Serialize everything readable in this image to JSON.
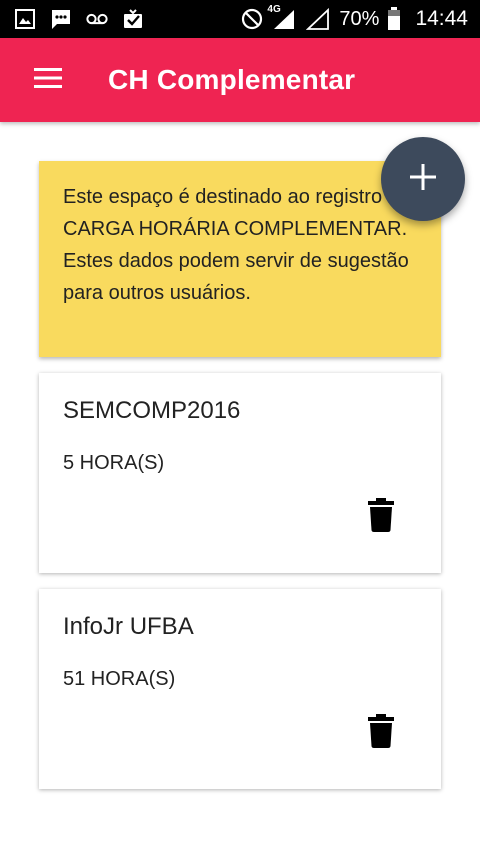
{
  "status_bar": {
    "left_icons": [
      "image-icon",
      "message-icon",
      "voicemail-icon",
      "download-done-icon"
    ],
    "network_label": "4G",
    "battery": "70%",
    "time": "14:44"
  },
  "app_bar": {
    "title": "CH Complementar",
    "menu_icon": "hamburger-menu-icon"
  },
  "info": {
    "text": "Este espaço é destinado ao registro da CARGA HORÁRIA COMPLEMENTAR. Estes dados podem servir de sugestão para outros usuários."
  },
  "fab": {
    "icon": "plus-icon"
  },
  "entries": [
    {
      "title": "SEMCOMP2016",
      "hours": "5 HORA(S)",
      "delete_icon": "trash-icon"
    },
    {
      "title": "InfoJr UFBA",
      "hours": "51 HORA(S)",
      "delete_icon": "trash-icon"
    }
  ],
  "colors": {
    "app_bar": "#ef2452",
    "info_card": "#f9da5e",
    "fab": "#3d4a5c"
  }
}
